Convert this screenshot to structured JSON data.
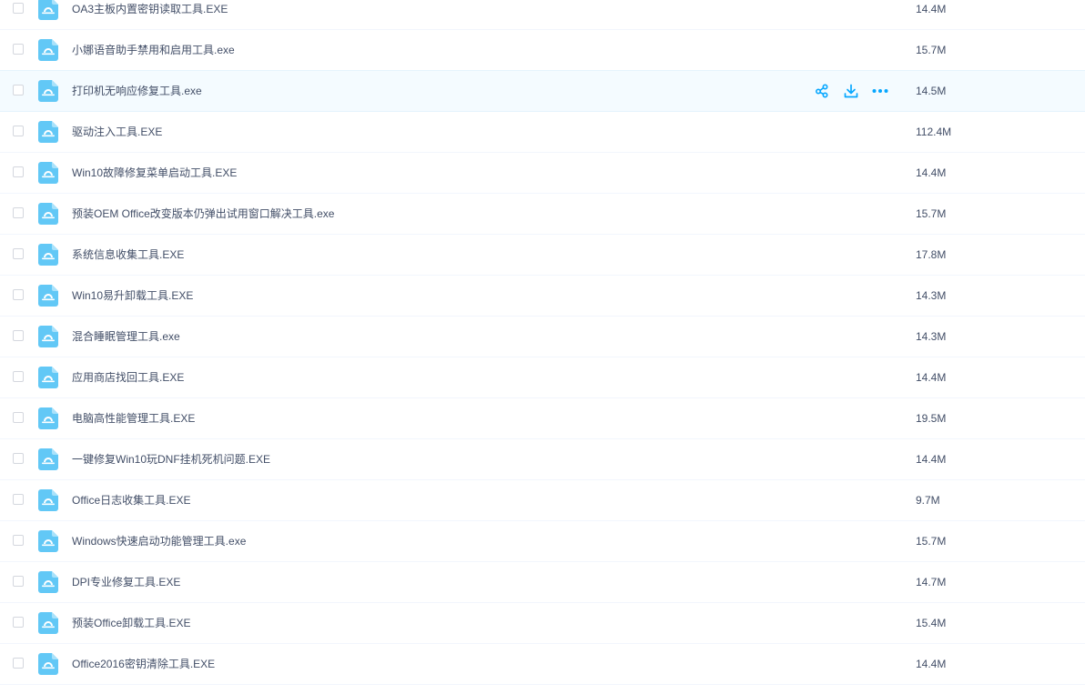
{
  "colors": {
    "accent": "#06a7ff",
    "icon_fill": "#62c8f6",
    "text": "#424e67",
    "row_hover": "#f4fbff"
  },
  "files": [
    {
      "name": "OA3主板内置密钥读取工具.EXE",
      "size": "14.4M",
      "icon": "exe-file-icon"
    },
    {
      "name": "小娜语音助手禁用和启用工具.exe",
      "size": "15.7M",
      "icon": "exe-file-icon"
    },
    {
      "name": "打印机无响应修复工具.exe",
      "size": "14.5M",
      "icon": "exe-file-icon",
      "hovered": true
    },
    {
      "name": "驱动注入工具.EXE",
      "size": "112.4M",
      "icon": "exe-file-icon"
    },
    {
      "name": "Win10故障修复菜单启动工具.EXE",
      "size": "14.4M",
      "icon": "exe-file-icon"
    },
    {
      "name": "预装OEM Office改变版本仍弹出试用窗口解决工具.exe",
      "size": "15.7M",
      "icon": "exe-file-icon"
    },
    {
      "name": "系统信息收集工具.EXE",
      "size": "17.8M",
      "icon": "exe-file-icon"
    },
    {
      "name": "Win10易升卸载工具.EXE",
      "size": "14.3M",
      "icon": "exe-file-icon"
    },
    {
      "name": "混合睡眠管理工具.exe",
      "size": "14.3M",
      "icon": "exe-file-icon"
    },
    {
      "name": "应用商店找回工具.EXE",
      "size": "14.4M",
      "icon": "exe-file-icon"
    },
    {
      "name": "电脑高性能管理工具.EXE",
      "size": "19.5M",
      "icon": "exe-file-icon"
    },
    {
      "name": "一键修复Win10玩DNF挂机死机问题.EXE",
      "size": "14.4M",
      "icon": "exe-file-icon"
    },
    {
      "name": "Office日志收集工具.EXE",
      "size": "9.7M",
      "icon": "exe-file-icon"
    },
    {
      "name": "Windows快速启动功能管理工具.exe",
      "size": "15.7M",
      "icon": "exe-file-icon"
    },
    {
      "name": "DPI专业修复工具.EXE",
      "size": "14.7M",
      "icon": "exe-file-icon"
    },
    {
      "name": "预装Office卸载工具.EXE",
      "size": "15.4M",
      "icon": "exe-file-icon"
    },
    {
      "name": "Office2016密钥清除工具.EXE",
      "size": "14.4M",
      "icon": "exe-file-icon"
    }
  ],
  "row_actions": [
    {
      "icon": "share-icon"
    },
    {
      "icon": "download-icon"
    },
    {
      "icon": "more-icon"
    }
  ]
}
